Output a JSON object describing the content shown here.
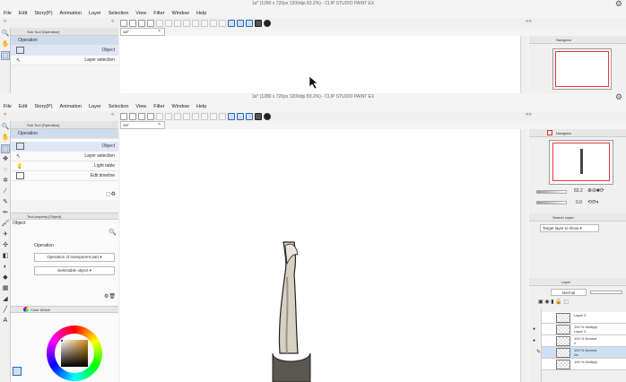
{
  "app": {
    "title": "1a* (1280 x 720px 1200dpi 83.2%)  - CLIP STUDIO PAINT EX"
  },
  "menu": [
    "File",
    "Edit",
    "Story(P)",
    "Animation",
    "Layer",
    "Selection",
    "View",
    "Filter",
    "Window",
    "Help"
  ],
  "panels": {
    "sub_tool_tab": "Sub Tool [Operation]",
    "doc_tab": "1a*",
    "doc_tab_close": "×",
    "sub_tool_group": "Operation",
    "sub_tools": [
      "Object",
      "Layer selection",
      "Light table",
      "Edit timeline"
    ],
    "tool_property_tab": "Tool property [Object]",
    "tool_property_title": "Object",
    "operation_label": "Operation",
    "operation_value": "Operation of transparent part",
    "selectable_label": "Selectable object",
    "color_wheel_tab": "Color Wheel",
    "navigator_tab": "Navigator",
    "nav_zoom": "83.2",
    "nav_rotate": "0.0",
    "search_layer_tab": "Search Layer",
    "target_layer": "Target layer to show",
    "layer_tab": "Layer",
    "blend_mode": "Normal"
  },
  "layers": [
    {
      "opacity": "",
      "mode": "",
      "name": "Layer 3"
    },
    {
      "opacity": "100 %",
      "mode": "Multiply",
      "name": "Layer 2"
    },
    {
      "opacity": "100 %",
      "mode": "Normal",
      "name": "2"
    },
    {
      "opacity": "100 %",
      "mode": "Normal",
      "name": "2a"
    },
    {
      "opacity": "100 %",
      "mode": "Multiply",
      "name": ""
    }
  ],
  "colors": {
    "accent": "#2a67b8",
    "selection": "#cfdcec",
    "navigator_frame": "#e33333"
  }
}
